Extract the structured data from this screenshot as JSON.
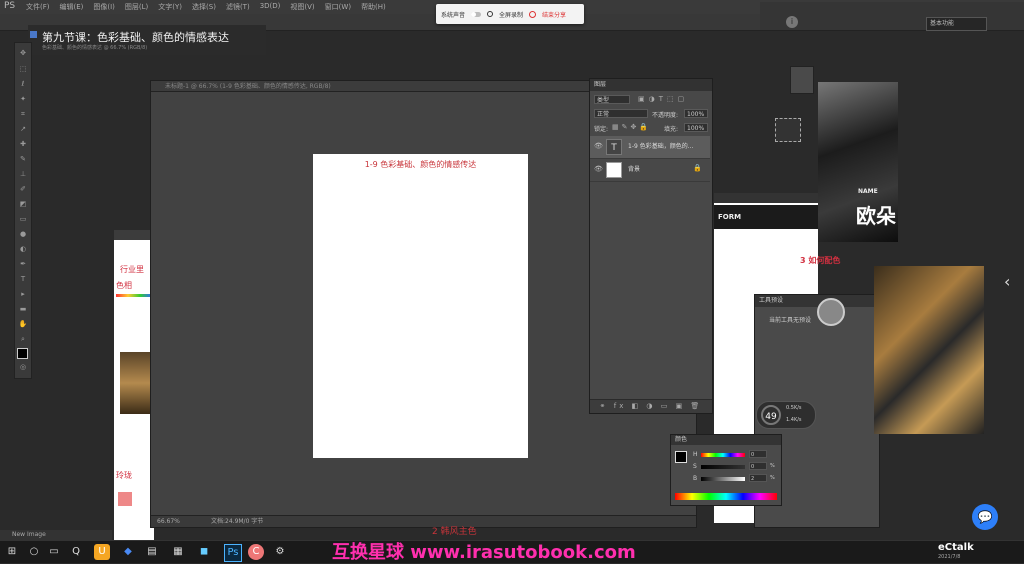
{
  "menubar": {
    "app": "PS",
    "menus": [
      "文件(F)",
      "编辑(E)",
      "图像(I)",
      "图层(L)",
      "文字(Y)",
      "选择(S)",
      "滤镜(T)",
      "3D(D)",
      "视图(V)",
      "窗口(W)",
      "帮助(H)"
    ]
  },
  "workspace": "基本功能",
  "recorder": {
    "system_sound": "系统声音",
    "region": "全屏录制",
    "stop": "结束分享"
  },
  "lesson": {
    "title": "第九节课：色彩基础、颜色的情感表达",
    "subtitle": "色彩基础、颜色的情感表达 @ 66.7% (RGB/8)"
  },
  "doc_main": {
    "tab": "未标题-1 @ 66.7% (1-9 色彩基础、颜色的情感传达, RGB/8)",
    "canvas_title": "1-9  色彩基础、颜色的情感传达",
    "zoom": "66.67%",
    "doc_size": "文档:24.9M/0 字节"
  },
  "doc_left": {
    "line1": "行业里",
    "line2": "色相"
  },
  "doc_right": {
    "form": "FORM",
    "heading": "3 如何配色",
    "bottom": "2 韩风主色"
  },
  "layers": {
    "title": "图层",
    "filter": "类型",
    "blend": "正常",
    "opacity_label": "不透明度:",
    "opacity": "100%",
    "lock_label": "锁定:",
    "fill_label": "填充:",
    "fill": "100%",
    "items": [
      {
        "name": "1-9 色彩基础，颜色的...",
        "type": "T"
      },
      {
        "name": "背景",
        "type": ""
      }
    ]
  },
  "props": {
    "title": "工具预设",
    "message": "当前工具无预设"
  },
  "gauge": {
    "value": "49",
    "unit": "%",
    "up": "0.5K/s",
    "down": "1.4K/s"
  },
  "color_panel": {
    "title": "颜色",
    "H": "0",
    "S": "0",
    "B": "2",
    "unit": "%"
  },
  "photo": {
    "name": "NAME",
    "big": "欧朵"
  },
  "nav_label": "New Image",
  "watermark": "互换星球 www.irasutobook.com",
  "taskbar_logo": "eCtalk",
  "taskbar_date": "2021/7/8"
}
